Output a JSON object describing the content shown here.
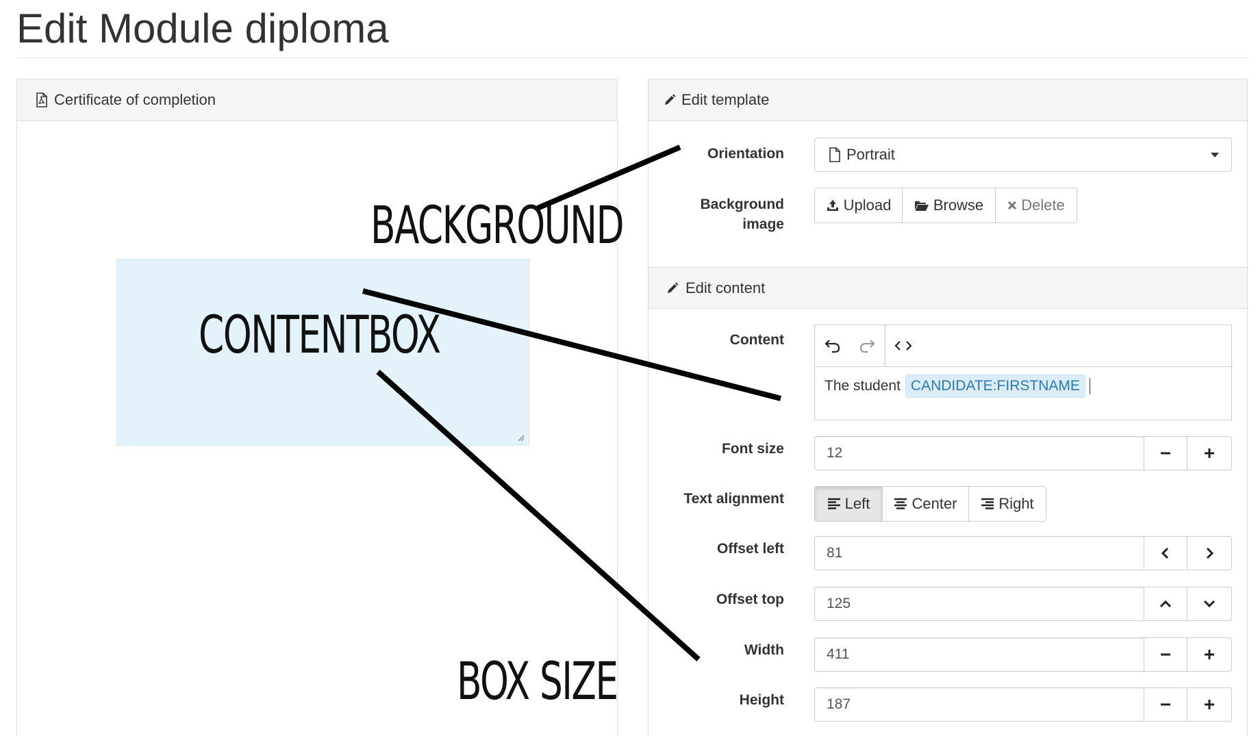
{
  "page": {
    "title": "Edit Module diploma"
  },
  "preview": {
    "heading": "Certificate of completion",
    "icon": "file-pdf-icon",
    "annotations": {
      "background": "BACKGROUND",
      "contentbox": "CONTENTBOX",
      "box_size": "BOX SIZE"
    },
    "content_box_color": "#e4f3fa"
  },
  "template": {
    "heading": "Edit template",
    "icon": "pencil-icon",
    "orientation": {
      "label": "Orientation",
      "value": "Portrait",
      "icon": "file-icon"
    },
    "background_image": {
      "label_line1": "Background",
      "label_line2": "image",
      "buttons": {
        "upload": "Upload",
        "browse": "Browse",
        "delete": "Delete"
      }
    }
  },
  "content": {
    "heading": "Edit content",
    "icon": "pencil-icon",
    "content_label": "Content",
    "editor": {
      "text": "The student",
      "placeholder_tag": "CANDIDATE:FIRSTNAME"
    },
    "font_size": {
      "label": "Font size",
      "value": "12"
    },
    "text_alignment": {
      "label": "Text alignment",
      "left": "Left",
      "center": "Center",
      "right": "Right",
      "selected": "Left"
    },
    "offset_left": {
      "label": "Offset left",
      "value": "81"
    },
    "offset_top": {
      "label": "Offset top",
      "value": "125"
    },
    "width": {
      "label": "Width",
      "value": "411"
    },
    "height": {
      "label": "Height",
      "value": "187"
    }
  },
  "colors": {
    "panel_heading_bg": "#f5f5f5",
    "border": "#dddddd",
    "tag_bg": "#dcecf7",
    "tag_text": "#2a7ab0"
  }
}
